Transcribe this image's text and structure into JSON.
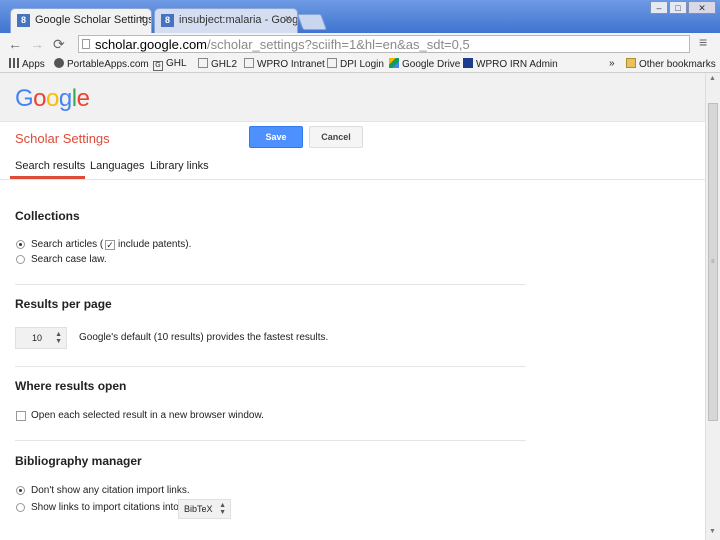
{
  "browser": {
    "tabs": [
      {
        "label": "Google Scholar Settings",
        "close": "×"
      },
      {
        "label": "insubject:malaria - Google",
        "close": "×"
      }
    ],
    "window_buttons": [
      "–",
      "□",
      "✕"
    ],
    "url_host": "scholar.google.com",
    "url_rest": "/scholar_settings?sciifh=1&hl=en&as_sdt=0,5",
    "bookmarks": [
      "Apps",
      "PortableApps.com",
      "GHL",
      "GHL2",
      "WPRO Intranet",
      "DPI Login",
      "Google Drive",
      "WPRO IRN Admin",
      "»",
      "Other bookmarks"
    ]
  },
  "page": {
    "logo": {
      "G": "G",
      "o1": "o",
      "o2": "o",
      "g": "g",
      "l": "l",
      "e": "e"
    },
    "title": "Scholar Settings",
    "save_label": "Save",
    "cancel_label": "Cancel",
    "tabs": [
      "Search results",
      "Languages",
      "Library links"
    ],
    "collections": {
      "heading": "Collections",
      "option1": "Search articles (",
      "option1_check": "include patents).",
      "option2": "Search case law."
    },
    "results": {
      "heading": "Results per page",
      "value": "10",
      "note": "Google's default (10 results) provides the fastest results."
    },
    "open": {
      "heading": "Where results open",
      "option": "Open each selected result in a new browser window."
    },
    "biblio": {
      "heading": "Bibliography manager",
      "option1": "Don't show any citation import links.",
      "option2": "Show links to import citations into",
      "select_value": "BibTeX"
    }
  },
  "colors": {
    "accent_red": "#dd4b39",
    "save_blue": "#4d90fe",
    "chrome_blue": "#3f74d0"
  }
}
